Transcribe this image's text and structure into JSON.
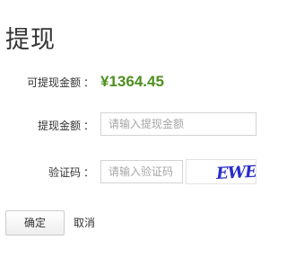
{
  "page": {
    "title": "提现"
  },
  "form": {
    "colon": "：",
    "balance": {
      "label": "可提现金额",
      "value": "¥1364.45",
      "value_color": "#4e8f1f"
    },
    "amount": {
      "label": "提现金额",
      "placeholder": "请输入提现金额",
      "value": ""
    },
    "captcha": {
      "label": "验证码",
      "placeholder": "请输入验证码",
      "value": "",
      "image_text": "EWEC",
      "image_color": "#2a2ec8"
    }
  },
  "actions": {
    "confirm_label": "确定",
    "cancel_label": "取消"
  }
}
